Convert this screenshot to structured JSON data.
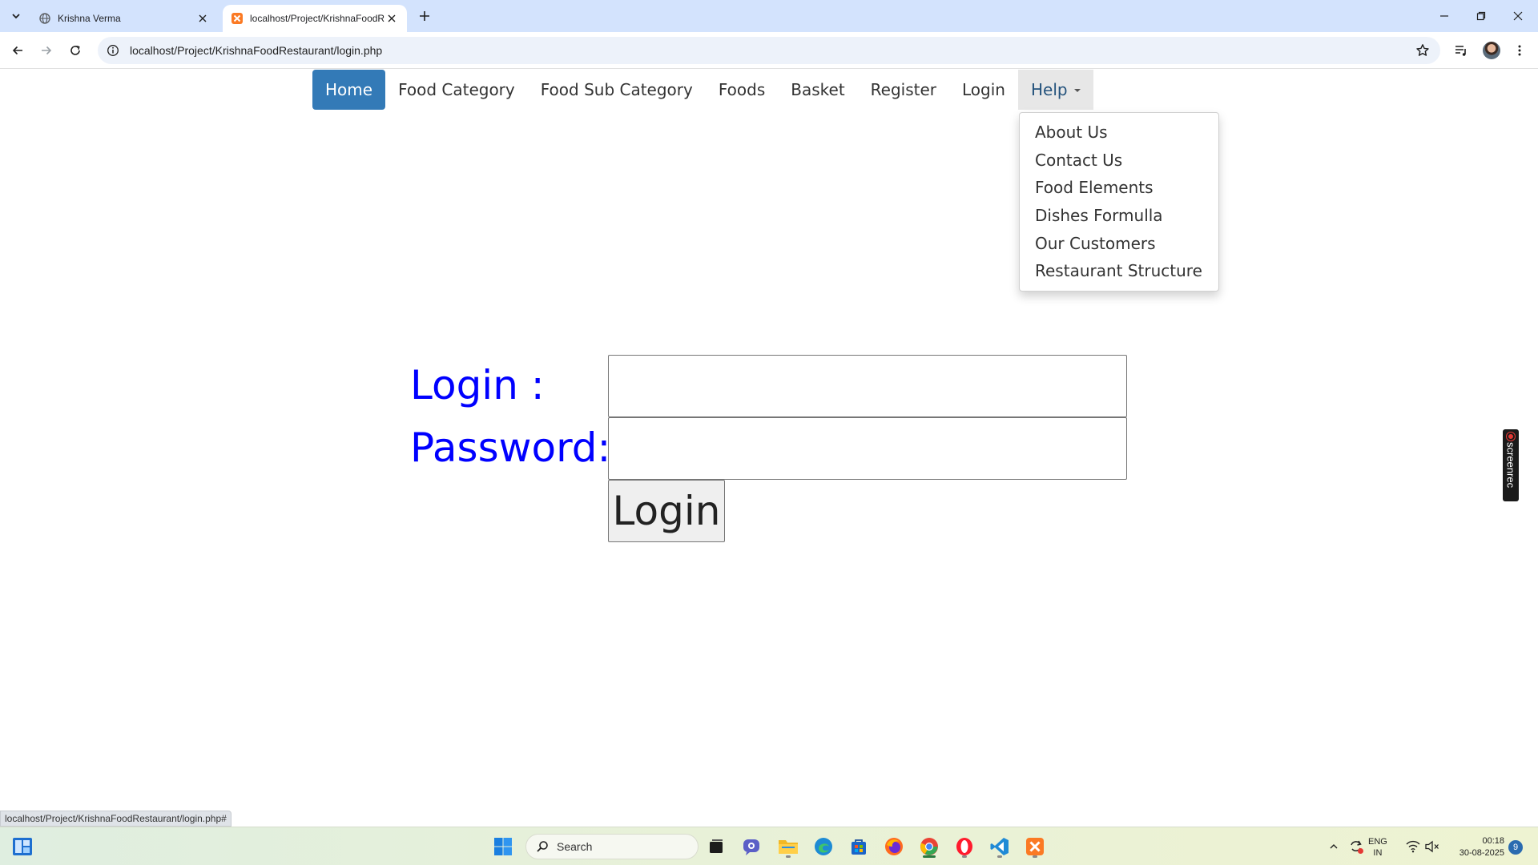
{
  "browser": {
    "tabs": [
      {
        "title": "Krishna Verma",
        "active": false,
        "favicon": "globe-icon"
      },
      {
        "title": "localhost/Project/KrishnaFoodR",
        "active": true,
        "favicon": "xampp-icon"
      }
    ],
    "address": "localhost/Project/KrishnaFoodRestaurant/login.php",
    "status_url": "localhost/Project/KrishnaFoodRestaurant/login.php#"
  },
  "nav": {
    "items": [
      {
        "label": "Home",
        "active": true
      },
      {
        "label": "Food Category"
      },
      {
        "label": "Food Sub Category"
      },
      {
        "label": "Foods"
      },
      {
        "label": "Basket"
      },
      {
        "label": "Register"
      },
      {
        "label": "Login"
      },
      {
        "label": "Help",
        "dropdown": true,
        "open": true
      }
    ],
    "help_menu": [
      "About Us",
      "Contact Us",
      "Food Elements",
      "Dishes Formulla",
      "Our Customers",
      "Restaurant Structure"
    ]
  },
  "login_form": {
    "login_label": "Login :",
    "password_label": "Password:",
    "login_value": "",
    "password_value": "",
    "submit_label": "Login"
  },
  "overlay": {
    "screenrec": "screenrec"
  },
  "taskbar": {
    "search_placeholder": "Search",
    "lang": {
      "line1": "ENG",
      "line2": "IN"
    },
    "time": "00:18",
    "date": "30-08-2025",
    "notifications": "9"
  },
  "colors": {
    "tabstrip": "#d3e3fd",
    "nav_active": "#337ab7",
    "form_label": "#0000ff"
  }
}
